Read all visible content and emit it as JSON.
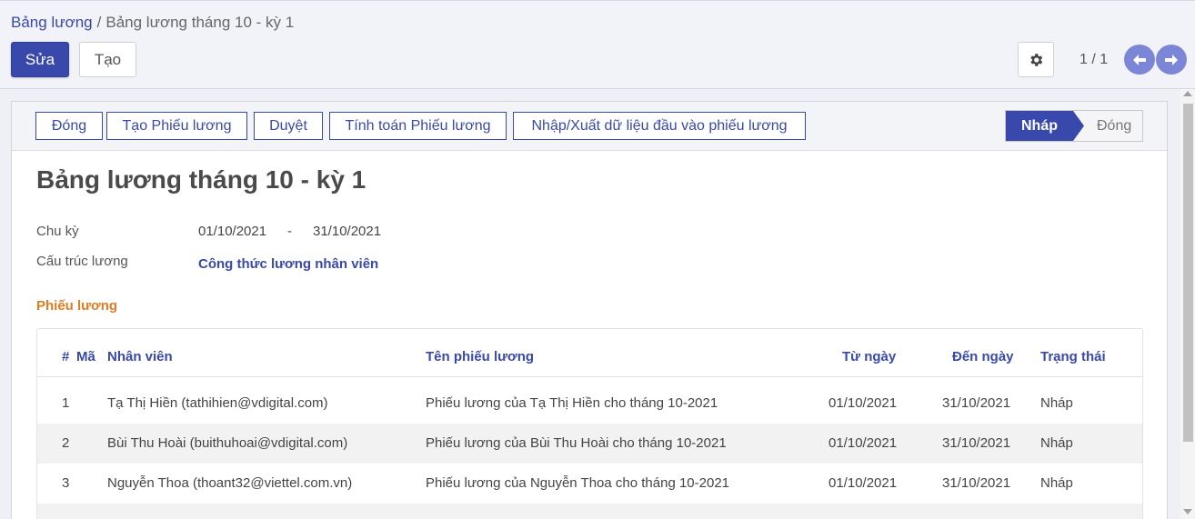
{
  "breadcrumb": {
    "parent": "Bảng lương",
    "separator": "/",
    "current": "Bảng lương tháng 10 - kỳ 1"
  },
  "toolbar": {
    "edit_label": "Sửa",
    "create_label": "Tạo",
    "settings_icon": "gear-icon",
    "pager": "1 / 1",
    "prev_icon": "arrow-left-icon",
    "next_icon": "arrow-right-icon"
  },
  "actions": {
    "close": "Đóng",
    "create_payslip": "Tạo Phiếu lương",
    "approve": "Duyệt",
    "compute_payslip": "Tính toán Phiếu lương",
    "import_export": "Nhập/Xuất dữ liệu đầu vào phiếu lương"
  },
  "status": {
    "active": "Nháp",
    "inactive": "Đóng"
  },
  "record": {
    "title": "Bảng lương tháng 10 - kỳ 1",
    "period_label": "Chu kỳ",
    "period_start": "01/10/2021",
    "period_separator": "-",
    "period_end": "31/10/2021",
    "structure_label": "Cấu trúc lương",
    "structure_value": "Công thức lương nhân viên"
  },
  "payslips": {
    "section_title": "Phiếu lương",
    "columns": {
      "index": "#",
      "code": "Mã",
      "employee": "Nhân viên",
      "name": "Tên phiếu lương",
      "date_from": "Từ ngày",
      "date_to": "Đến ngày",
      "state": "Trạng thái"
    },
    "rows": [
      {
        "index": "1",
        "employee": "Tạ Thị Hiền (tathihien@vdigital.com)",
        "name": "Phiếu lương của Tạ Thị Hiền cho tháng 10-2021",
        "date_from": "01/10/2021",
        "date_to": "31/10/2021",
        "state": "Nháp"
      },
      {
        "index": "2",
        "employee": "Bùi Thu Hoài (buithuhoai@vdigital.com)",
        "name": "Phiếu lương của Bùi Thu Hoài cho tháng 10-2021",
        "date_from": "01/10/2021",
        "date_to": "31/10/2021",
        "state": "Nháp"
      },
      {
        "index": "3",
        "employee": "Nguyễn Thoa (thoant32@viettel.com.vn)",
        "name": "Phiếu lương của Nguyễn Thoa cho tháng 10-2021",
        "date_from": "01/10/2021",
        "date_to": "31/10/2021",
        "state": "Nháp"
      }
    ]
  },
  "colors": {
    "primary": "#3949ab",
    "section_accent": "#e07b20",
    "nav_button": "#7b86d6"
  }
}
